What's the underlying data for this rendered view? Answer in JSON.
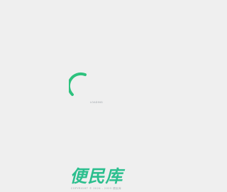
{
  "loader": {
    "spinner_icon": "loading-spinner-icon",
    "accent_color": "#2ec27e",
    "text": "LOADING"
  },
  "brand": {
    "logo_text": "便民库",
    "brand_color": "#2bbf8e"
  },
  "footer": {
    "copyright": "COPYRIGHT © 2024 - 2025 便民库"
  },
  "background_color": "#efefef"
}
